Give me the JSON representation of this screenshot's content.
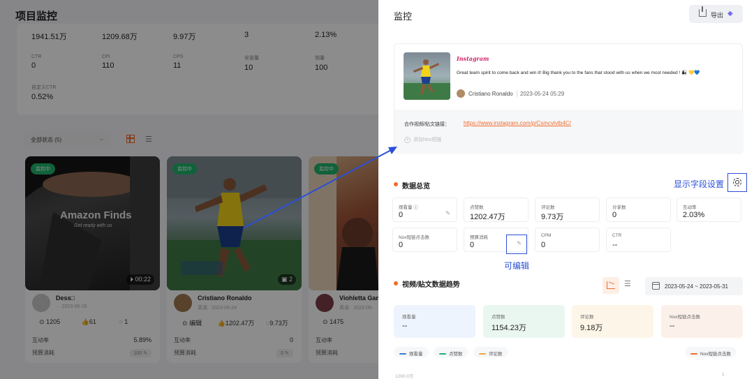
{
  "bg": {
    "title": "项目监控",
    "stats": {
      "row1": [
        "1941.51万",
        "1209.68万",
        "9.97万",
        "3",
        "2.13%"
      ],
      "row2": [
        {
          "label": "CTR",
          "value": "0"
        },
        {
          "label": "CPI",
          "value": "110"
        },
        {
          "label": "CPS",
          "value": "11"
        },
        {
          "label": "安装量",
          "value": "10"
        },
        {
          "label": "销量",
          "value": "100"
        }
      ],
      "row3": {
        "label": "自定义CTR",
        "value": "0.52%"
      }
    },
    "filter": {
      "status": "全部状态 (5)",
      "chevron": "⌄",
      "list_glyph": "☰"
    },
    "cards": [
      {
        "badge": "监控中",
        "thumb_text": "Amazon Finds",
        "thumb_script": "Get ready with us",
        "duration": "00:22",
        "name": "Dess□",
        "date": "· · 2023-06-29",
        "m1": "1205",
        "m2": "61",
        "m3": "1",
        "rate_label": "互动率",
        "rate": "5.89%",
        "budget_label": "预算消耗",
        "budget": "100"
      },
      {
        "badge": "监控中",
        "duration": "2",
        "name": "Cristiano Ronaldo",
        "date": "英语 · 2023-05-24",
        "m1": "编辑",
        "m2": "1202.47万",
        "m3": "9.73万",
        "rate_label": "互动率",
        "rate": "0",
        "budget_label": "预算消耗",
        "budget": "0"
      },
      {
        "badge": "监控中",
        "name": "Viohletta Gam",
        "date": "英语 · 2023-05-",
        "m1": "1475",
        "rate_label": "互动率",
        "budget_label": "预算消耗"
      }
    ]
  },
  "drawer": {
    "title": "监控",
    "export_label": "导出",
    "post": {
      "platform": "Instagram",
      "text": "Great team spirit to come back and win it! Big thank you to the fans that stood with us when we most needed ! 👨‍👧 💛💙",
      "author": "Cristiano Ronaldo",
      "time": "2023-05-24 05:29",
      "link_label": "合作视频/贴文链接：",
      "link_url": "https://www.instagram.com/p/Csmcvlvtb4C/",
      "add_link": "添加Nox短链"
    },
    "overview": {
      "title": "数据总览",
      "settings_hint": "显示字段设置",
      "edit_hint": "可编辑",
      "metrics": [
        {
          "label": "观看量 ⓘ",
          "value": "0",
          "editable": true
        },
        {
          "label": "点赞数",
          "value": "1202.47万"
        },
        {
          "label": "评论数",
          "value": "9.73万"
        },
        {
          "label": "分享数",
          "value": "0"
        },
        {
          "label": "互动率",
          "value": "2.03%"
        },
        {
          "label": "Nox短链点击数",
          "value": "0"
        },
        {
          "label": "预算消耗",
          "value": "0",
          "editable": true
        },
        {
          "label": "CPM",
          "value": "0"
        },
        {
          "label": "CTR",
          "value": "--"
        }
      ]
    },
    "trend": {
      "title": "视频/贴文数据趋势",
      "date_range": "2023-05-24  ~  2023-05-31",
      "list_glyph": "☰",
      "cards": [
        {
          "label": "观看量",
          "value": "--",
          "bg": "#eef4fd"
        },
        {
          "label": "点赞数",
          "value": "1154.23万",
          "bg": "#eaf7f1"
        },
        {
          "label": "评论数",
          "value": "9.18万",
          "bg": "#fdf5e8"
        },
        {
          "label": "Nox短链点击数",
          "value": "--",
          "bg": "#fcf1ea"
        }
      ],
      "legend": [
        {
          "label": "观看量",
          "color": "#3a7bd5"
        },
        {
          "label": "点赞数",
          "color": "#1fb26b"
        },
        {
          "label": "评论数",
          "color": "#f0a73a"
        }
      ],
      "legend_right": {
        "label": "Nox短链点击数",
        "color": "#f26a2c"
      },
      "y_top": "1200.0万",
      "y_right": "1"
    }
  }
}
